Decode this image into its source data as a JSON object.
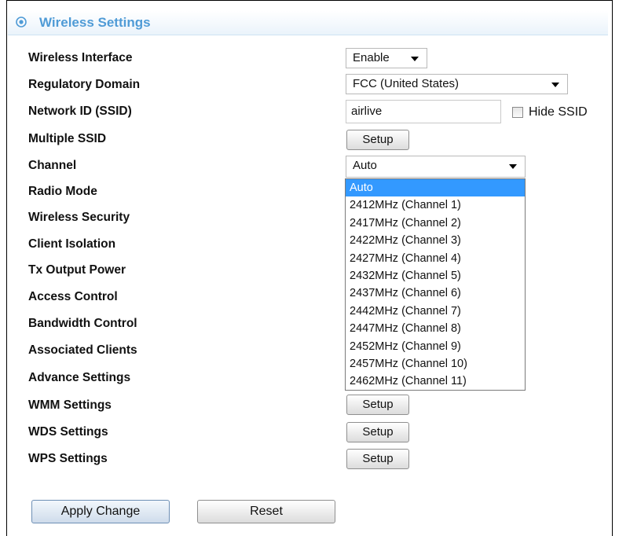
{
  "header": {
    "title": "Wireless Settings",
    "icon": "settings-circle-icon",
    "accent_color": "#4f9bd6"
  },
  "rows": {
    "wireless_interface": {
      "label": "Wireless Interface",
      "value": "Enable"
    },
    "regulatory_domain": {
      "label": "Regulatory Domain",
      "value": "FCC (United States)"
    },
    "network_id": {
      "label": "Network ID (SSID)",
      "value": "airlive",
      "hide_ssid_label": "Hide SSID",
      "hide_ssid_checked": false
    },
    "multiple_ssid": {
      "label": "Multiple SSID",
      "button": "Setup"
    },
    "channel": {
      "label": "Channel",
      "value": "Auto"
    },
    "radio_mode": {
      "label": "Radio Mode"
    },
    "wireless_security": {
      "label": "Wireless Security"
    },
    "client_isolation": {
      "label": "Client Isolation"
    },
    "tx_output_power": {
      "label": "Tx Output Power"
    },
    "access_control": {
      "label": "Access Control"
    },
    "bandwidth_control": {
      "label": "Bandwidth Control"
    },
    "associated_clients": {
      "label": "Associated Clients"
    },
    "advance_settings": {
      "label": "Advance Settings"
    },
    "wmm_settings": {
      "label": "WMM Settings",
      "button": "Setup"
    },
    "wds_settings": {
      "label": "WDS Settings",
      "button": "Setup"
    },
    "wps_settings": {
      "label": "WPS Settings",
      "button": "Setup"
    }
  },
  "channel_dropdown": {
    "options": [
      "Auto",
      "2412MHz (Channel 1)",
      "2417MHz (Channel 2)",
      "2422MHz (Channel 3)",
      "2427MHz (Channel 4)",
      "2432MHz (Channel 5)",
      "2437MHz (Channel 6)",
      "2442MHz (Channel 7)",
      "2447MHz (Channel 8)",
      "2452MHz (Channel 9)",
      "2457MHz (Channel 10)",
      "2462MHz (Channel 11)"
    ],
    "highlight_color": "#3399ff"
  },
  "footer": {
    "apply_label": "Apply Change",
    "reset_label": "Reset"
  }
}
